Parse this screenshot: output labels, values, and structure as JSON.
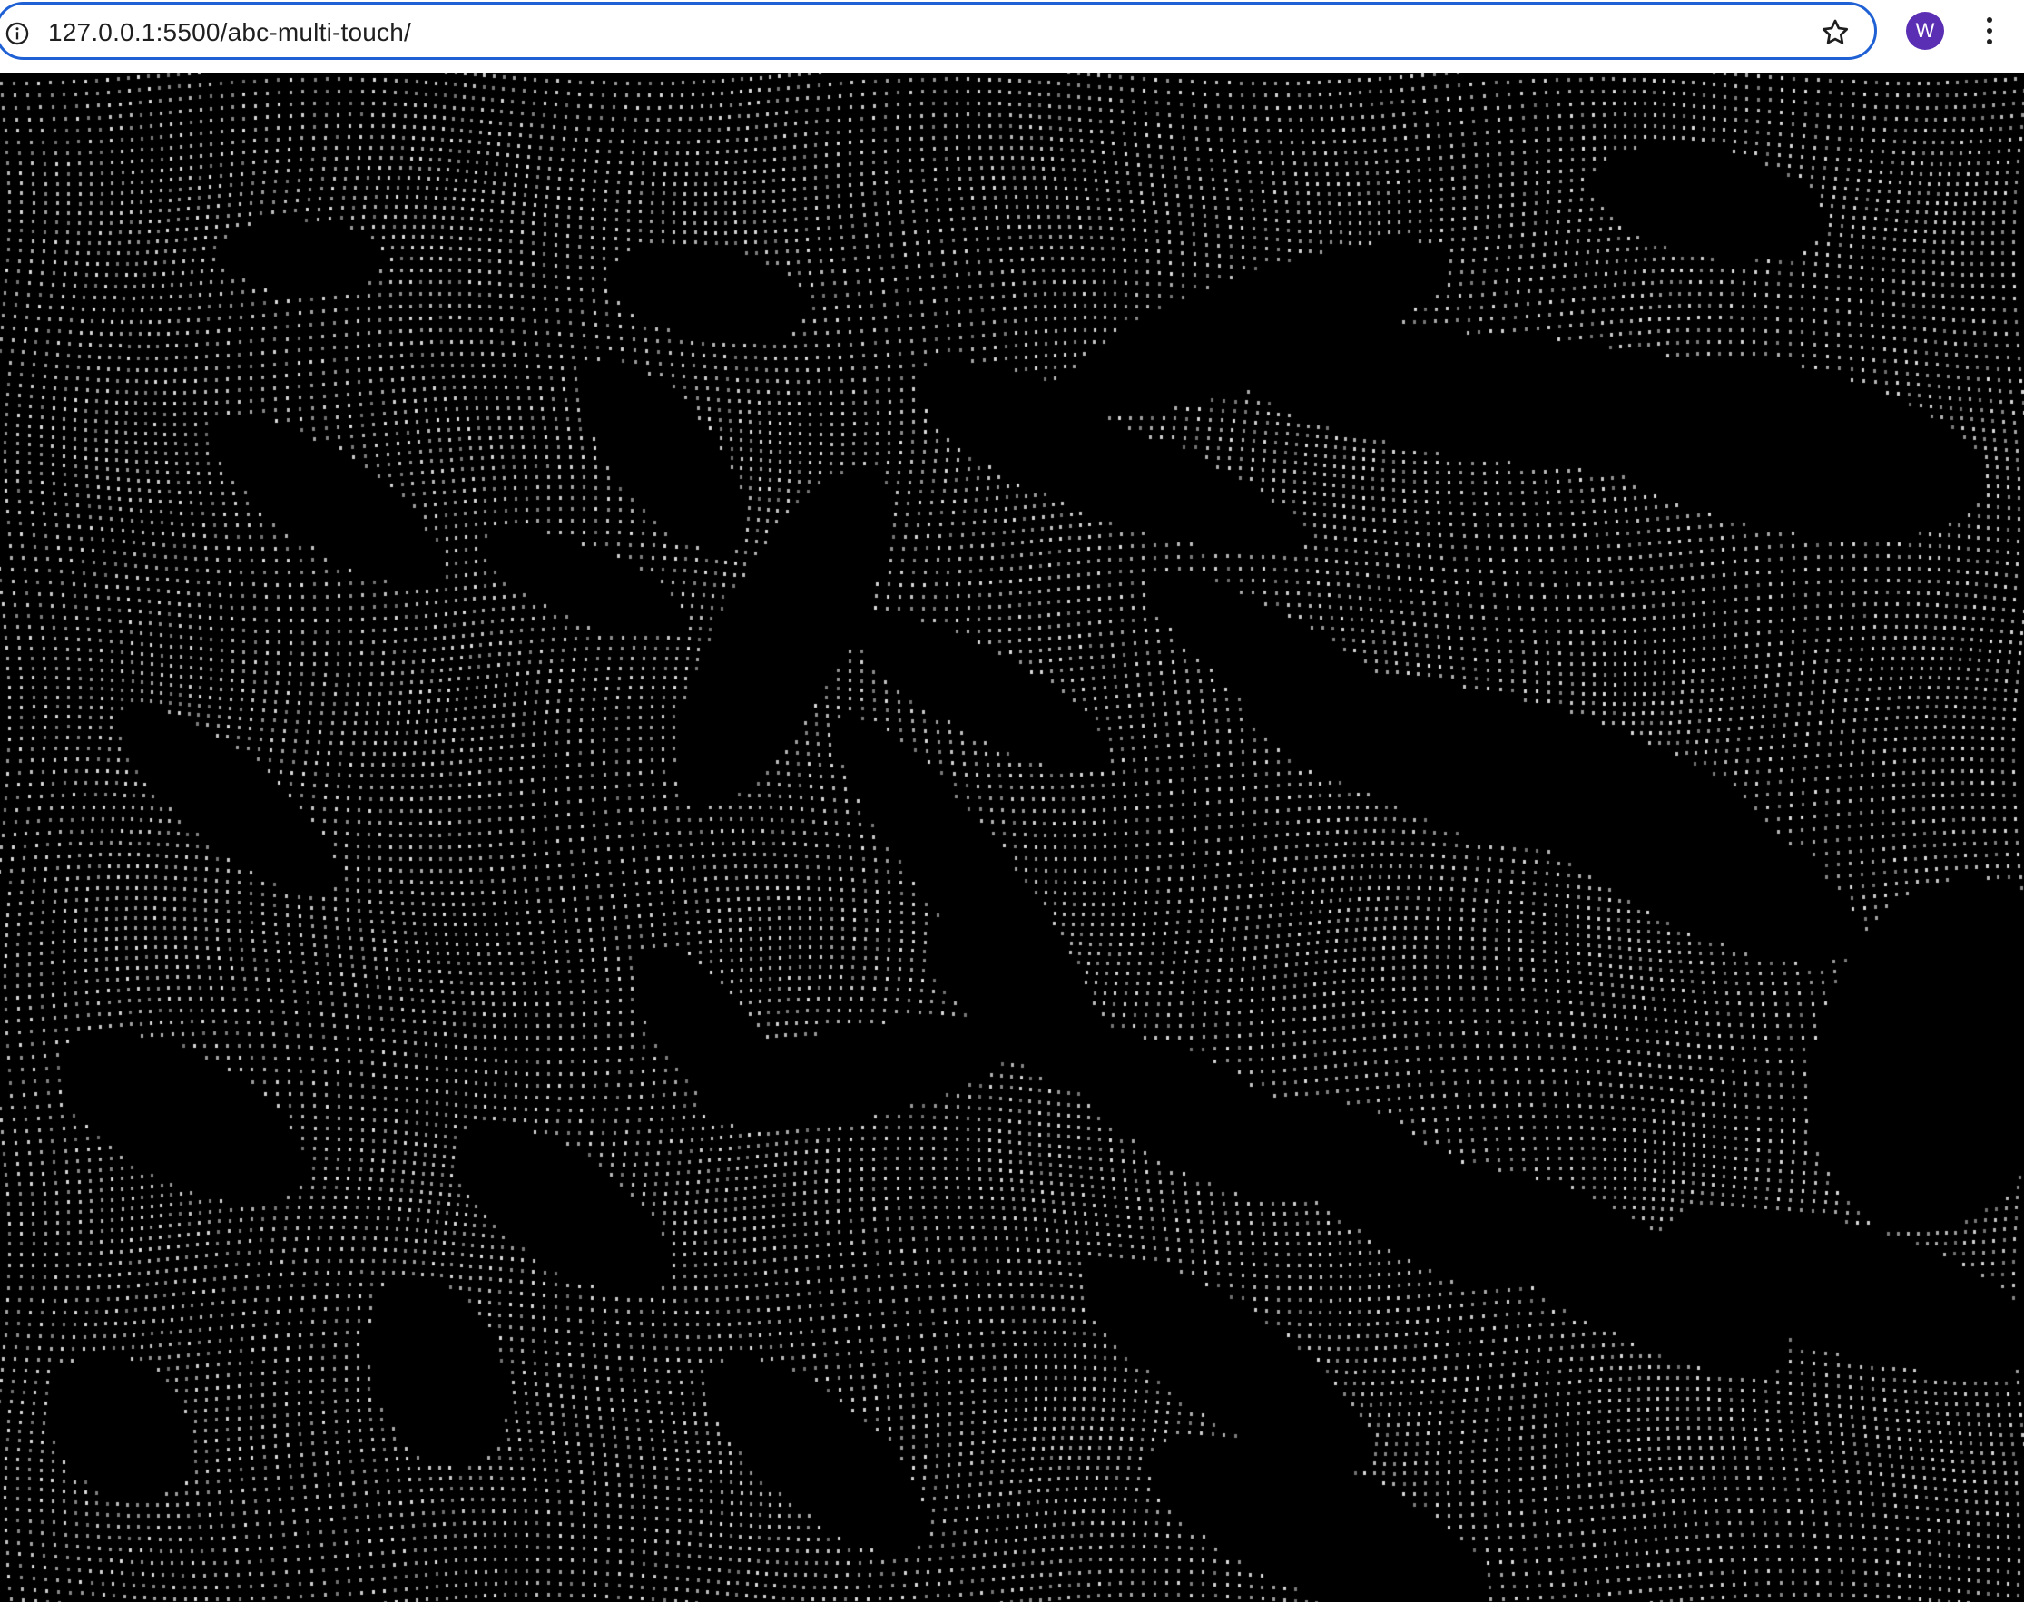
{
  "browser": {
    "url": "127.0.0.1:5500/abc-multi-touch/",
    "profile_initial": "W",
    "profile_color": "#5a2fb4",
    "focus_ring_color": "#1f61d4",
    "icons": {
      "site_info": "info-circle-icon",
      "bookmark": "star-outline-icon",
      "menu": "vertical-dots-icon"
    }
  },
  "page": {
    "background": "#000000",
    "dot_color": "#d8d8d8"
  }
}
